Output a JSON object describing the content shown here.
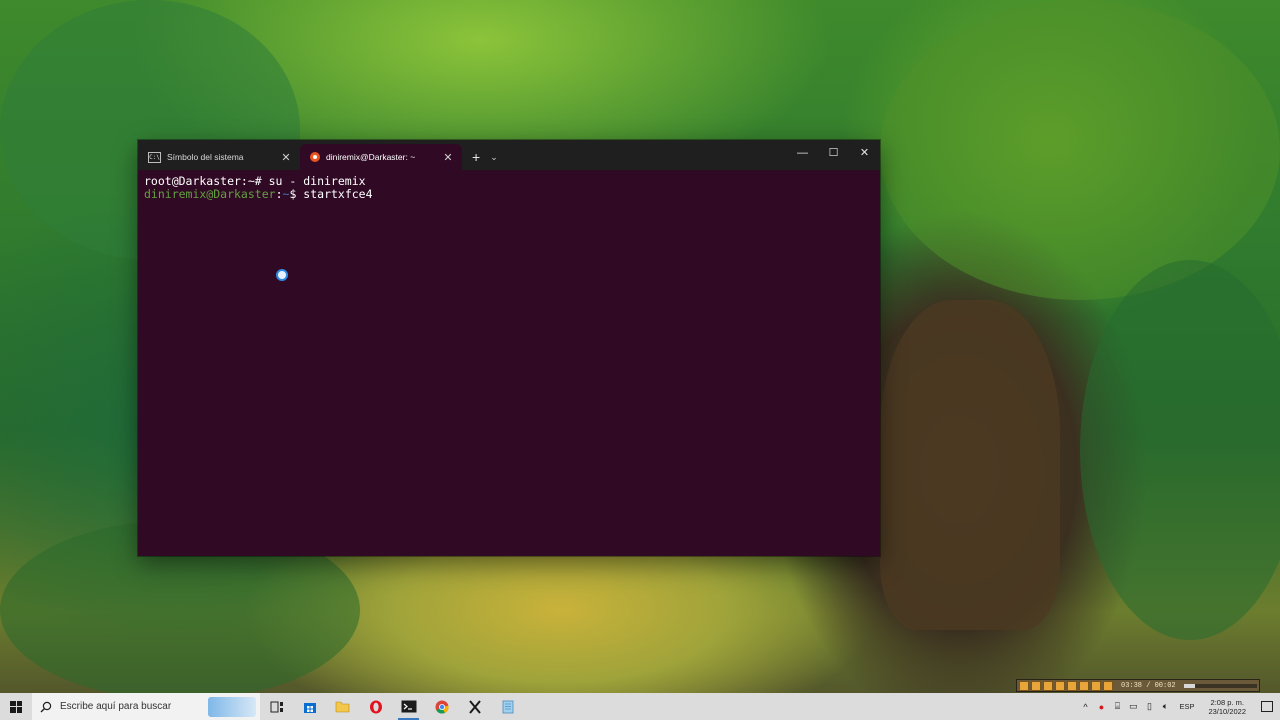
{
  "terminal": {
    "tabs": [
      {
        "title": "Símbolo del sistema",
        "icon": "cmd-icon",
        "active": false
      },
      {
        "title": "diniremix@Darkaster: ~",
        "icon": "ubuntu-icon",
        "active": true
      }
    ],
    "new_tab_glyph": "+",
    "dropdown_glyph": "⌄",
    "window_controls": {
      "minimize": "—",
      "maximize": "☐",
      "close": "✕"
    },
    "lines": [
      {
        "prompt": "root@Darkaster:~# ",
        "command": "su - diniremix"
      },
      {
        "user": "diniremix@Darkaster",
        "sep": ":",
        "path": "~",
        "prompt_end": "$ ",
        "command": "startxfce4"
      }
    ],
    "background_color": "#300a24"
  },
  "media_player": {
    "time": "03:38 / 00:02",
    "progress": 0.15
  },
  "taskbar": {
    "search_placeholder": "Escribe aquí para buscar",
    "apps": [
      {
        "name": "task-view-icon",
        "running": false
      },
      {
        "name": "store-icon",
        "running": false
      },
      {
        "name": "file-explorer-icon",
        "running": false
      },
      {
        "name": "opera-icon",
        "running": false
      },
      {
        "name": "terminal-icon",
        "running": true
      },
      {
        "name": "chrome-icon",
        "running": false
      },
      {
        "name": "x-app-icon",
        "running": false
      },
      {
        "name": "notepad-icon",
        "running": false
      }
    ],
    "tray": {
      "language": "ESP",
      "time": "2:08 p. m.",
      "date": "23/10/2022"
    }
  }
}
